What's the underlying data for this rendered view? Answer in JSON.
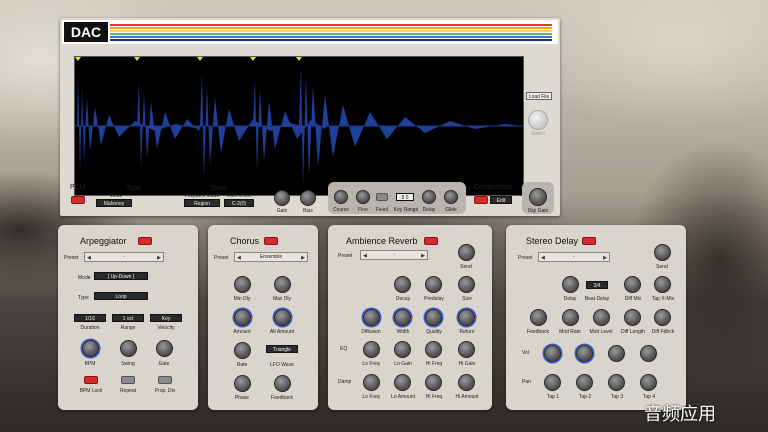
{
  "app": {
    "logo": "DAC",
    "stripe_colors": [
      "#e03b2c",
      "#f0a030",
      "#f4e23a",
      "#5bbf4a",
      "#3a7bd5",
      "#1f2f7a"
    ]
  },
  "sampler": {
    "load_file": "Load File",
    "select_label": "Select",
    "pcm": "PCM",
    "type": "Type",
    "mode_label": "Mode",
    "mode_value": "Mahoney",
    "slicer": "Slicer",
    "playback_mode_label": "Playback Mode",
    "playback_mode_value": "Region",
    "midi_offset_label": "MIDI Offset",
    "midi_offset_value": "C-2(0)",
    "gain": "Gain",
    "bias": "Bias",
    "coarse": "Coarse",
    "fine": "Fine",
    "fixed": "Fixed",
    "key_range": "Key Range",
    "key_range_value": "8 0",
    "delay": "Delay",
    "glide": "Glide",
    "compressor": "Compressor",
    "compressor_value": "Edit",
    "digi_gain": "Digi Gain"
  },
  "arp": {
    "title": "Arpeggiator",
    "preset": "Preset",
    "preset_value": "-",
    "mode": "Mode",
    "mode_value": "[ Up-Down ]",
    "type": "Type",
    "type_value": "Loop",
    "duration_value": "1/16",
    "range_value": "1 oct",
    "velocity_value": "Key",
    "duration": "Duration",
    "range": "Range",
    "velocity": "Velocity",
    "bpm": "BPM",
    "swing": "Swing",
    "gate": "Gate",
    "bpm_lock": "BPM Lock",
    "repeat": "Repeat",
    "prop_div": "Prop. Div"
  },
  "chorus": {
    "title": "Chorus",
    "preset": "Preset",
    "preset_value": "Ensemble",
    "min_dly": "Min Dly",
    "max_dly": "Max Dly",
    "amount": "Amount",
    "alt_amount": "Alt Amount",
    "rate": "Rate",
    "lfo_wave": "LFO Wave",
    "lfo_wave_value": "Triangle",
    "phase": "Phase",
    "feedback": "Feedback"
  },
  "reverb": {
    "title": "Ambience Reverb",
    "preset": "Preset",
    "preset_value": "-",
    "send": "Send",
    "decay": "Decay",
    "predelay": "Predelay",
    "size": "Size",
    "diffusion": "Diffusion",
    "width": "Width",
    "quality": "Quality",
    "return": "Return",
    "eq": "EQ",
    "lo_freq": "Lo Freq",
    "lo_gain": "Lo Gain",
    "hi_freq": "Hi Freq",
    "hi_gain": "Hi Gain",
    "damp": "Damp",
    "lo_amount": "Lo Amount",
    "hi_amount": "Hi Amount"
  },
  "delay": {
    "title": "Stereo Delay",
    "preset": "Preset",
    "preset_value": "-",
    "send": "Send",
    "beat_value": "3/4",
    "delay": "Delay",
    "beat_delay": "Beat Delay",
    "diff_mix": "Diff Mix",
    "tap_x_mix": "Tap X-Mix",
    "feedback": "Feedback",
    "mod_rate": "Mod Rate",
    "mod_level": "Mod Level",
    "diff_length": "Diff Length",
    "diff_fdbk": "Diff Fdbck",
    "vol": "Vol",
    "pan": "Pan",
    "tap1": "Tap 1",
    "tap2": "Tap 2",
    "tap3": "Tap 3",
    "tap4": "Tap 4"
  },
  "watermark": "音频应用"
}
